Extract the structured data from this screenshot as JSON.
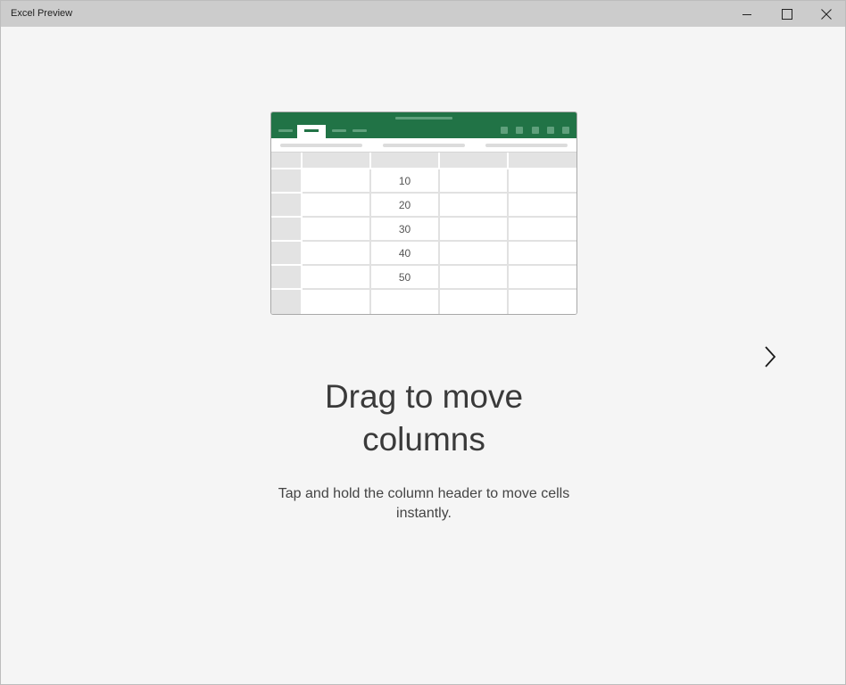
{
  "window": {
    "title": "Excel Preview"
  },
  "illustration": {
    "accent_color": "#217346",
    "column_values": [
      "10",
      "20",
      "30",
      "40",
      "50",
      ""
    ]
  },
  "slide": {
    "heading_line1": "Drag to move",
    "heading_line2": "columns",
    "description_line1": "Tap and hold the column header to move cells",
    "description_line2": "instantly."
  },
  "icons": {
    "minimize": "minimize-icon",
    "maximize": "maximize-icon",
    "close": "close-icon",
    "next": "chevron-right-icon"
  }
}
